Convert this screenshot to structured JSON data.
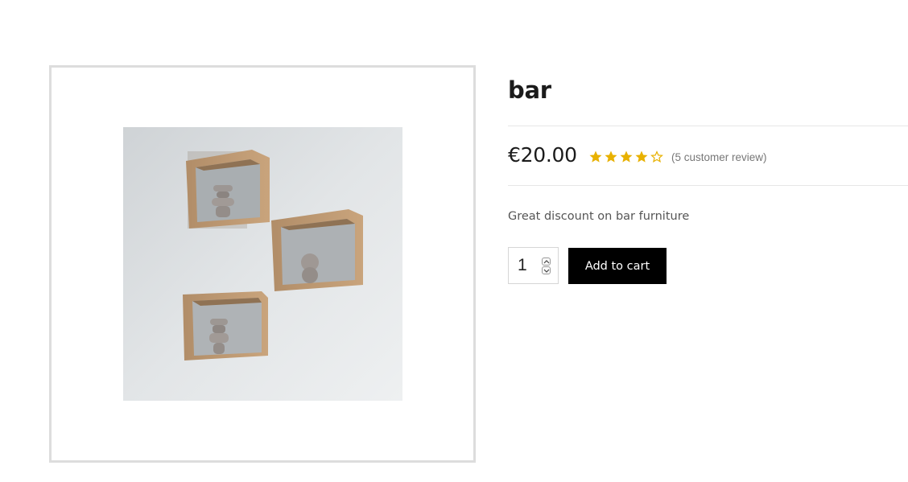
{
  "product": {
    "title": "bar",
    "price": "€20.00",
    "rating": 4,
    "rating_max": 5,
    "review_link": "(5 customer review)",
    "description": "Great discount on bar furniture",
    "image_icon": "wall-shelves-photo"
  },
  "cart": {
    "quantity": "1",
    "add_to_cart_label": "Add to cart"
  },
  "colors": {
    "star": "#e8b100",
    "button_bg": "#000000",
    "button_text": "#ffffff",
    "border": "#dddddd"
  }
}
